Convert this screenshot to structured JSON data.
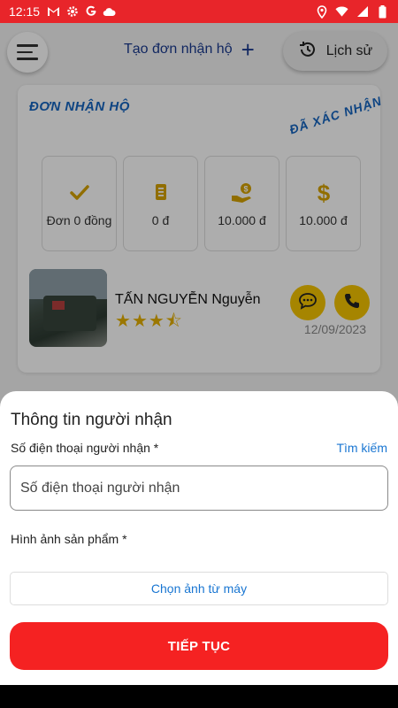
{
  "status_bar": {
    "time": "12:15",
    "left_icons": [
      "gmail-icon",
      "settings-icon",
      "google-icon",
      "cloud-icon"
    ],
    "right_icons": [
      "location-icon",
      "wifi-icon",
      "signal-icon",
      "battery-icon"
    ]
  },
  "header": {
    "create_order_label": "Tạo đơn nhận hộ",
    "history_label": "Lịch sử"
  },
  "order_card": {
    "title": "ĐƠN NHẬN HỘ",
    "status_stamp": "ĐÃ XÁC NHẬN",
    "stats": [
      {
        "icon": "check-icon",
        "value": "Đơn 0 đồng"
      },
      {
        "icon": "receipt-icon",
        "value": "0 đ"
      },
      {
        "icon": "money-hand-icon",
        "value": "10.000 đ"
      },
      {
        "icon": "dollar-icon",
        "value": "10.000 đ"
      }
    ],
    "shop_name": "TẤN NGUYỄN Nguyễn",
    "rating": 3.5,
    "date": "12/09/2023"
  },
  "sheet": {
    "title": "Thông tin người nhận",
    "phone_label": "Số điện thoại người nhận *",
    "search_link": "Tìm kiếm",
    "phone_placeholder": "Số điện thoại người nhận",
    "phone_value": "",
    "image_label": "Hình ảnh sản phẩm *",
    "pick_image_label": "Chọn ảnh từ máy",
    "continue_label": "TIẾP TỤC"
  },
  "colors": {
    "status_bar": "#e8252a",
    "accent_blue": "#1565c0",
    "accent_yellow": "#f5c400",
    "primary_button": "#f52222",
    "link": "#1976d2"
  }
}
